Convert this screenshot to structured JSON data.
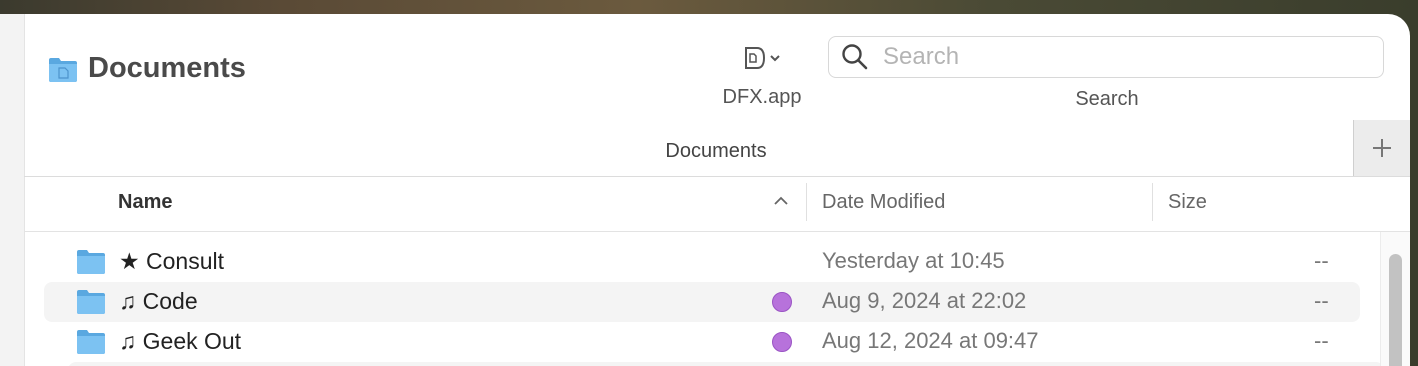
{
  "window": {
    "title": "Documents",
    "folder_icon": "folder-icon"
  },
  "toolbar": {
    "app_button_label": "DFX.app",
    "app_button_icon": "dfx-app-icon",
    "search_placeholder": "Search",
    "search_caption": "Search"
  },
  "tabs": [
    {
      "label": "Documents"
    }
  ],
  "columns": {
    "name": "Name",
    "date_modified": "Date Modified",
    "size": "Size",
    "sort_direction": "ascending"
  },
  "files": [
    {
      "name": "★ Consult",
      "date": "Yesterday at 10:45",
      "size": "--",
      "tag_color": ""
    },
    {
      "name": "♫ Code",
      "date": "Aug 9, 2024 at 22:02",
      "size": "--",
      "tag_color": "#b772db"
    },
    {
      "name": "♫ Geek Out",
      "date": "Aug 12, 2024 at 09:47",
      "size": "--",
      "tag_color": "#b772db"
    }
  ],
  "colors": {
    "accent_folder": "#6cb8ee",
    "tag_purple": "#b772db"
  }
}
